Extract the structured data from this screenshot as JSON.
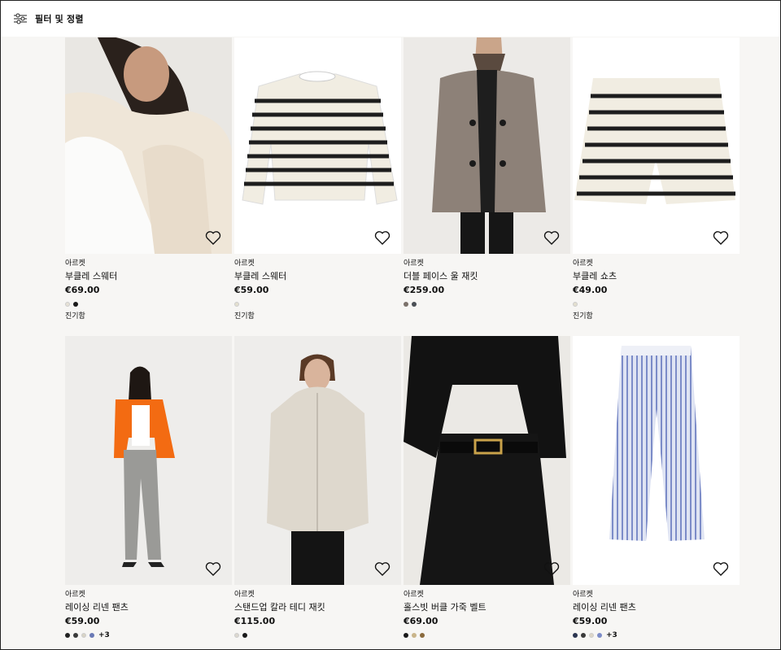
{
  "toolbar": {
    "filter_label": "필터 및 정렬",
    "filter_icon": "sliders-icon"
  },
  "products": [
    {
      "brand": "아르켓",
      "name": "부클레 스웨터",
      "price": "€69.00",
      "swatches": [
        "#e6e1d6",
        "#1a1a1a"
      ],
      "more": "",
      "tag": "진기함"
    },
    {
      "brand": "아르켓",
      "name": "부클레 스웨터",
      "price": "€59.00",
      "swatches": [
        "#e3dfcf"
      ],
      "more": "",
      "tag": "진기함"
    },
    {
      "brand": "아르켓",
      "name": "더블 페이스 울 재킷",
      "price": "€259.00",
      "swatches": [
        "#7b716a",
        "#4b4f55"
      ],
      "more": "",
      "tag": ""
    },
    {
      "brand": "아르켓",
      "name": "부클레 쇼츠",
      "price": "€49.00",
      "swatches": [
        "#e3dfcf"
      ],
      "more": "",
      "tag": "진기함"
    },
    {
      "brand": "아르켓",
      "name": "레이싱 리넨 팬츠",
      "price": "€59.00",
      "swatches": [
        "#222222",
        "#3a3a3a",
        "#d9d4c6",
        "#6a79b5"
      ],
      "more": "+3",
      "tag": ""
    },
    {
      "brand": "아르켓",
      "name": "스탠드업 칼라 테디 재킷",
      "price": "€115.00",
      "swatches": [
        "#dcd8cf",
        "#1a1a1a"
      ],
      "more": "",
      "tag": ""
    },
    {
      "brand": "아르켓",
      "name": "홀스빗 버클 가죽 벨트",
      "price": "€69.00",
      "swatches": [
        "#1a1a1a",
        "#c9b48a",
        "#8a6a3c"
      ],
      "more": "",
      "tag": ""
    },
    {
      "brand": "아르켓",
      "name": "레이싱 리넨 팬츠",
      "price": "€59.00",
      "swatches": [
        "#2b3550",
        "#3a3a3a",
        "#ddd7c8",
        "#7c8cc8"
      ],
      "more": "+3",
      "tag": ""
    }
  ]
}
